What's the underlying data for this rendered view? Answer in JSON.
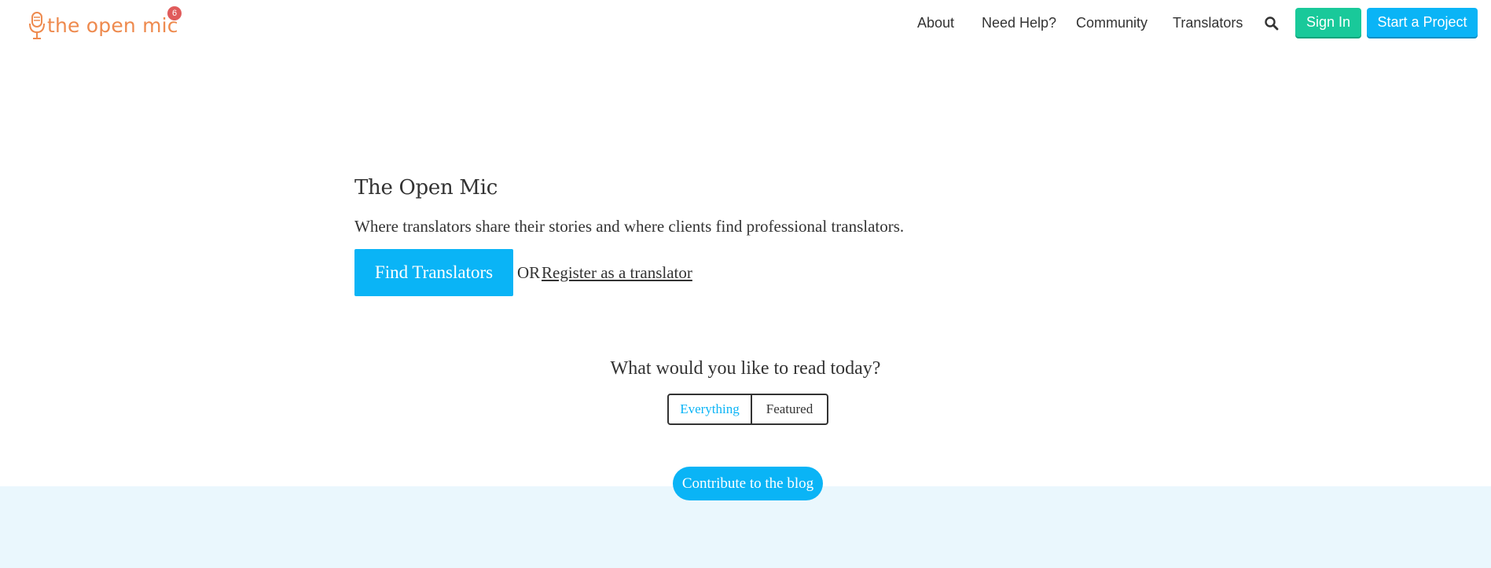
{
  "brand": {
    "logo_text": "the open mic",
    "notification_count": "6",
    "logo_color": "#ee8a4e"
  },
  "nav": {
    "items": [
      {
        "label": "About"
      },
      {
        "label": "Need Help?"
      },
      {
        "label": "Community"
      },
      {
        "label": "Translators"
      }
    ],
    "search_icon": "search-icon",
    "sign_in_label": "Sign In",
    "start_project_label": "Start a Project"
  },
  "hero": {
    "title": "The Open Mic",
    "subtitle": "Where translators share their stories and where clients find professional translators.",
    "find_button_label": "Find Translators",
    "or_text": "OR",
    "register_link_label": "Register as a translator"
  },
  "read": {
    "question": "What would you like to read today?",
    "options": [
      {
        "label": "Everything",
        "selected": true
      },
      {
        "label": "Featured",
        "selected": false
      }
    ]
  },
  "blog": {
    "contribute_label": "Contribute to the blog"
  },
  "colors": {
    "accent_blue": "#0ab4f6",
    "accent_green": "#19c99a",
    "badge_red": "#e05b5b",
    "band_bg": "#eaf7fd"
  }
}
